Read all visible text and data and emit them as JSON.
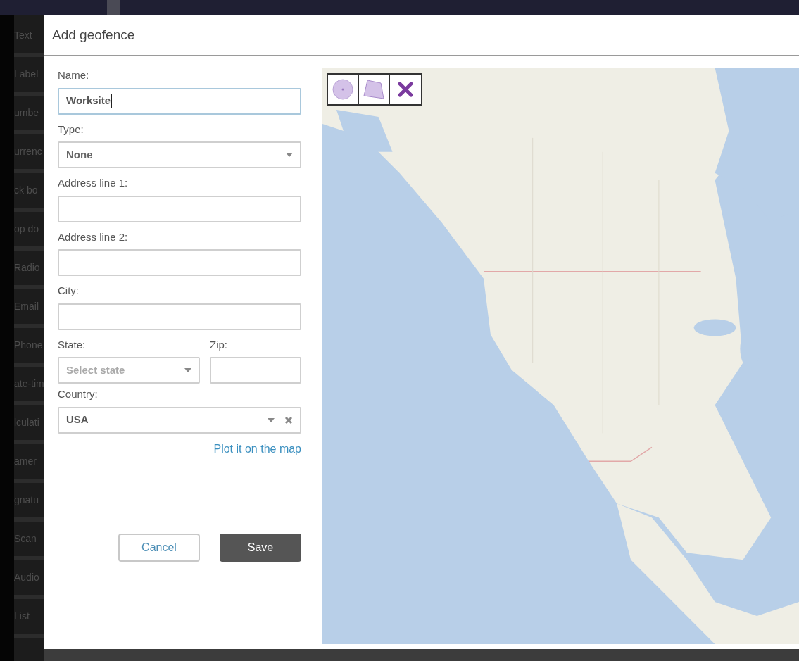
{
  "sidebar": {
    "items": [
      "Text",
      "Label",
      "umbe",
      "urrenc",
      "ck bo",
      "op do",
      "Radio",
      "Email",
      "Phone",
      "ate-tim",
      "lculati",
      "amer",
      "gnatu",
      "Scan",
      "Audio",
      "List"
    ]
  },
  "dialog": {
    "title": "Add geofence",
    "form": {
      "name": {
        "label": "Name:",
        "value": "Worksite",
        "focused": true
      },
      "type": {
        "label": "Type:",
        "value": "None"
      },
      "address1": {
        "label": "Address line 1:",
        "focused": false
      },
      "address2": {
        "label": "Address line 2:",
        "focused": false
      },
      "city": {
        "label": "City:",
        "focused": false
      },
      "state": {
        "label": "State:",
        "placeholder": "Select state"
      },
      "zip": {
        "label": "Zip:",
        "focused": false
      },
      "country": {
        "label": "Country:",
        "value": "USA"
      },
      "plot_link": "Plot it on the map"
    },
    "buttons": [
      {
        "kind": "secondary",
        "label": "Cancel"
      },
      {
        "kind": "primary",
        "label": "Save"
      }
    ]
  }
}
